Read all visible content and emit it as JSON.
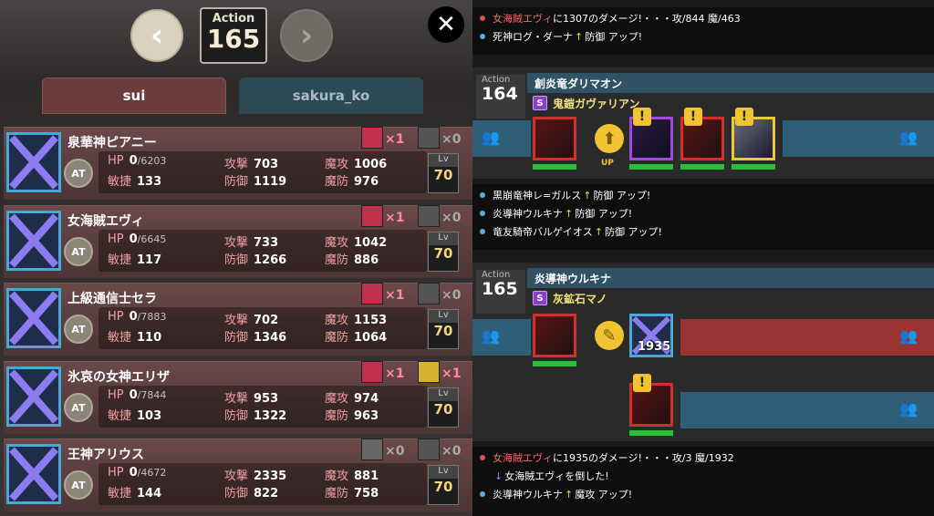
{
  "nav": {
    "action_label": "Action",
    "action_number": "165",
    "prev_icon": "chevron-left",
    "next_icon": "chevron-right",
    "close_icon": "close"
  },
  "tabs": [
    {
      "label": "sui"
    },
    {
      "label": "sakura_ko"
    }
  ],
  "units": [
    {
      "name": "泉華神ピアニー",
      "hp": "0",
      "hp_max": "/6203",
      "atk": "703",
      "mag_atk": "1006",
      "agi": "133",
      "def": "1119",
      "mag_def": "976",
      "lv": "70",
      "equip1_count": "×1",
      "equip2_count": "×0"
    },
    {
      "name": "女海賊エヴィ",
      "hp": "0",
      "hp_max": "/6645",
      "atk": "733",
      "mag_atk": "1042",
      "agi": "117",
      "def": "1266",
      "mag_def": "886",
      "lv": "70",
      "equip1_count": "×1",
      "equip2_count": "×0"
    },
    {
      "name": "上級通信士セラ",
      "hp": "0",
      "hp_max": "/7883",
      "atk": "702",
      "mag_atk": "1153",
      "agi": "110",
      "def": "1346",
      "mag_def": "1064",
      "lv": "70",
      "equip1_count": "×1",
      "equip2_count": "×0"
    },
    {
      "name": "氷哀の女神エリザ",
      "hp": "0",
      "hp_max": "/7844",
      "atk": "953",
      "mag_atk": "974",
      "agi": "103",
      "def": "1322",
      "mag_def": "963",
      "lv": "70",
      "equip1_count": "×1",
      "equip2_count": "×1"
    },
    {
      "name": "王神アリウス",
      "hp": "0",
      "hp_max": "/4672",
      "atk": "2335",
      "mag_atk": "881",
      "agi": "144",
      "def": "822",
      "mag_def": "758",
      "lv": "70",
      "equip1_count": "×0",
      "equip2_count": "×0"
    }
  ],
  "labels": {
    "hp": "HP",
    "atk": "攻撃",
    "mag_atk": "魔攻",
    "agi": "敏捷",
    "def": "防御",
    "mag_def": "魔防",
    "lv": "Lv",
    "at": "AT"
  },
  "log_top": [
    {
      "name": "女海賊エヴィ",
      "text": "に1307のダメージ!・・・攻/844 魔/463",
      "color": "red"
    },
    {
      "name": "死神ログ・ダーナ",
      "up": "↑",
      "text": "防御 アップ!",
      "color": "blue"
    }
  ],
  "action164": {
    "label": "Action",
    "number": "164",
    "attacker": "創炎竜ダリマオン",
    "skill": "鬼鎧ガヴァリアン",
    "skill_badge": "S",
    "buff_label": "UP"
  },
  "log_mid": [
    {
      "name": "黒崩竜神レ=ガルス",
      "up": "↑",
      "text": "防御 アップ!"
    },
    {
      "name": "炎導神ウルキナ",
      "up": "↑",
      "text": "防御 アップ!"
    },
    {
      "name": "竜友騎帝バルゲイオス",
      "up": "↑",
      "text": "防御 アップ!"
    }
  ],
  "action165": {
    "label": "Action",
    "number": "165",
    "attacker": "炎導神ウルキナ",
    "skill": "灰鉱石マノ",
    "skill_badge": "S",
    "damage": "1935"
  },
  "log_bottom": [
    {
      "name": "女海賊エヴィ",
      "text": "に1935のダメージ!・・・攻/3 魔/1932",
      "color": "red"
    },
    {
      "down": "↓",
      "text": "女海賊エヴィを倒した!",
      "color": "none"
    },
    {
      "name": "炎導神ウルキナ",
      "up": "↑",
      "text": "魔攻 アップ!",
      "color": "blue"
    }
  ],
  "colors": {
    "hp_green": "#2bbf3a",
    "accent_red": "#d03030",
    "lane_blue": "#2f5f78",
    "lane_red": "#9b3333"
  }
}
